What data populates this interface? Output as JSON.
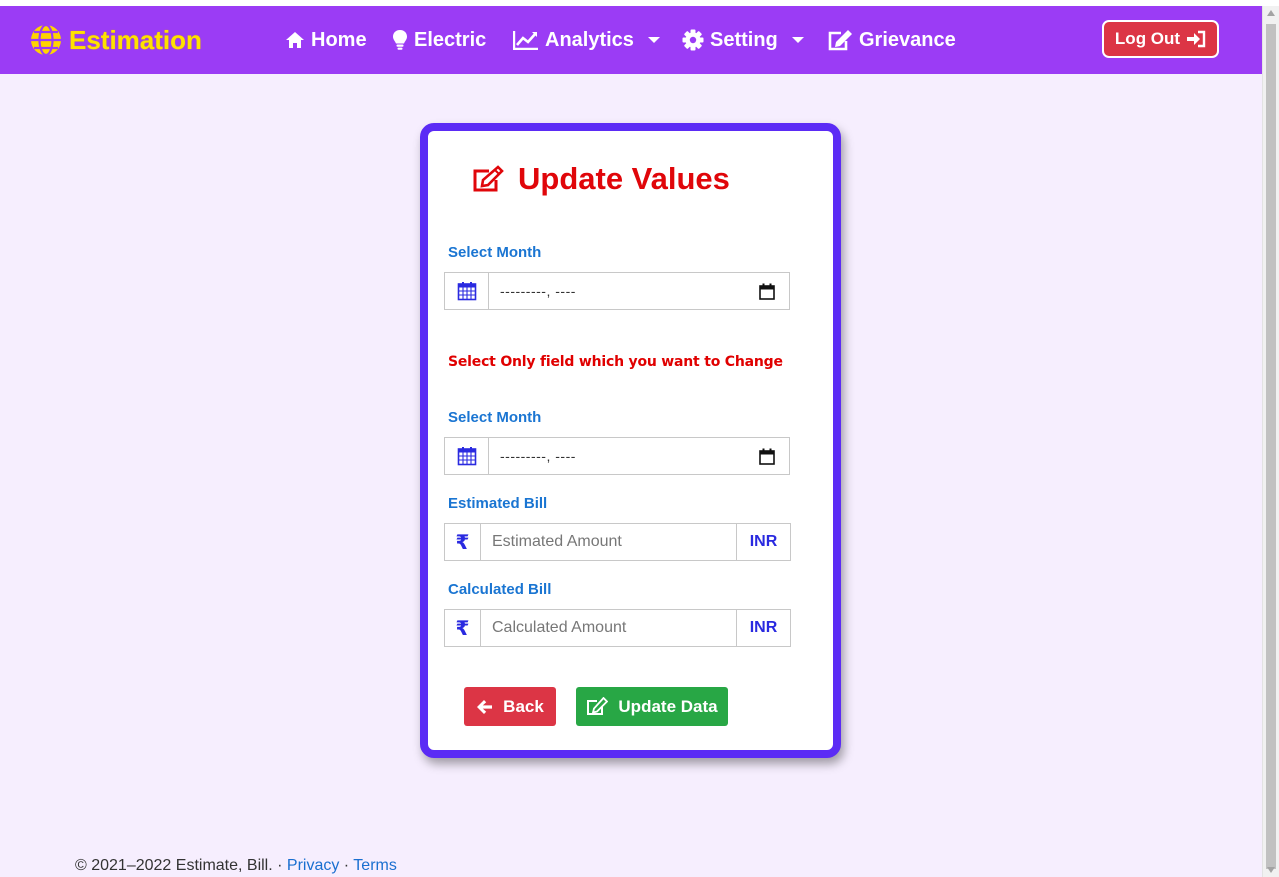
{
  "navbar": {
    "brand": "Estimation",
    "items": [
      {
        "label": "Home",
        "icon": "home-icon"
      },
      {
        "label": "Electric",
        "icon": "lightbulb-icon"
      },
      {
        "label": "Analytics",
        "icon": "line-chart-icon",
        "dropdown": true
      },
      {
        "label": "Setting",
        "icon": "gear-icon",
        "dropdown": true
      },
      {
        "label": "Grievance",
        "icon": "edit-icon"
      }
    ],
    "logout_label": "Log Out",
    "bg_color": "#9b3cf5",
    "brand_color": "#ffe100"
  },
  "form": {
    "title": "Update Values",
    "select_month_label_1": "Select Month",
    "month_value_1": "---------, ----",
    "warning": "Select Only field which you want to Change",
    "select_month_label_2": "Select Month",
    "month_value_2": "---------, ----",
    "estimated_label": "Estimated Bill",
    "estimated_placeholder": "Estimated Amount",
    "calculated_label": "Calculated Bill",
    "calculated_placeholder": "Calculated Amount",
    "currency": "INR",
    "currency_symbol": "₹",
    "back_label": "Back",
    "update_label": "Update Data",
    "border_color": "#5b2bf5",
    "title_color": "#e0060a"
  },
  "footer": {
    "copyright": "© 2021–2022 Estimate, Bill.",
    "sep1": " · ",
    "privacy": "Privacy",
    "sep2": " · ",
    "terms": "Terms"
  }
}
